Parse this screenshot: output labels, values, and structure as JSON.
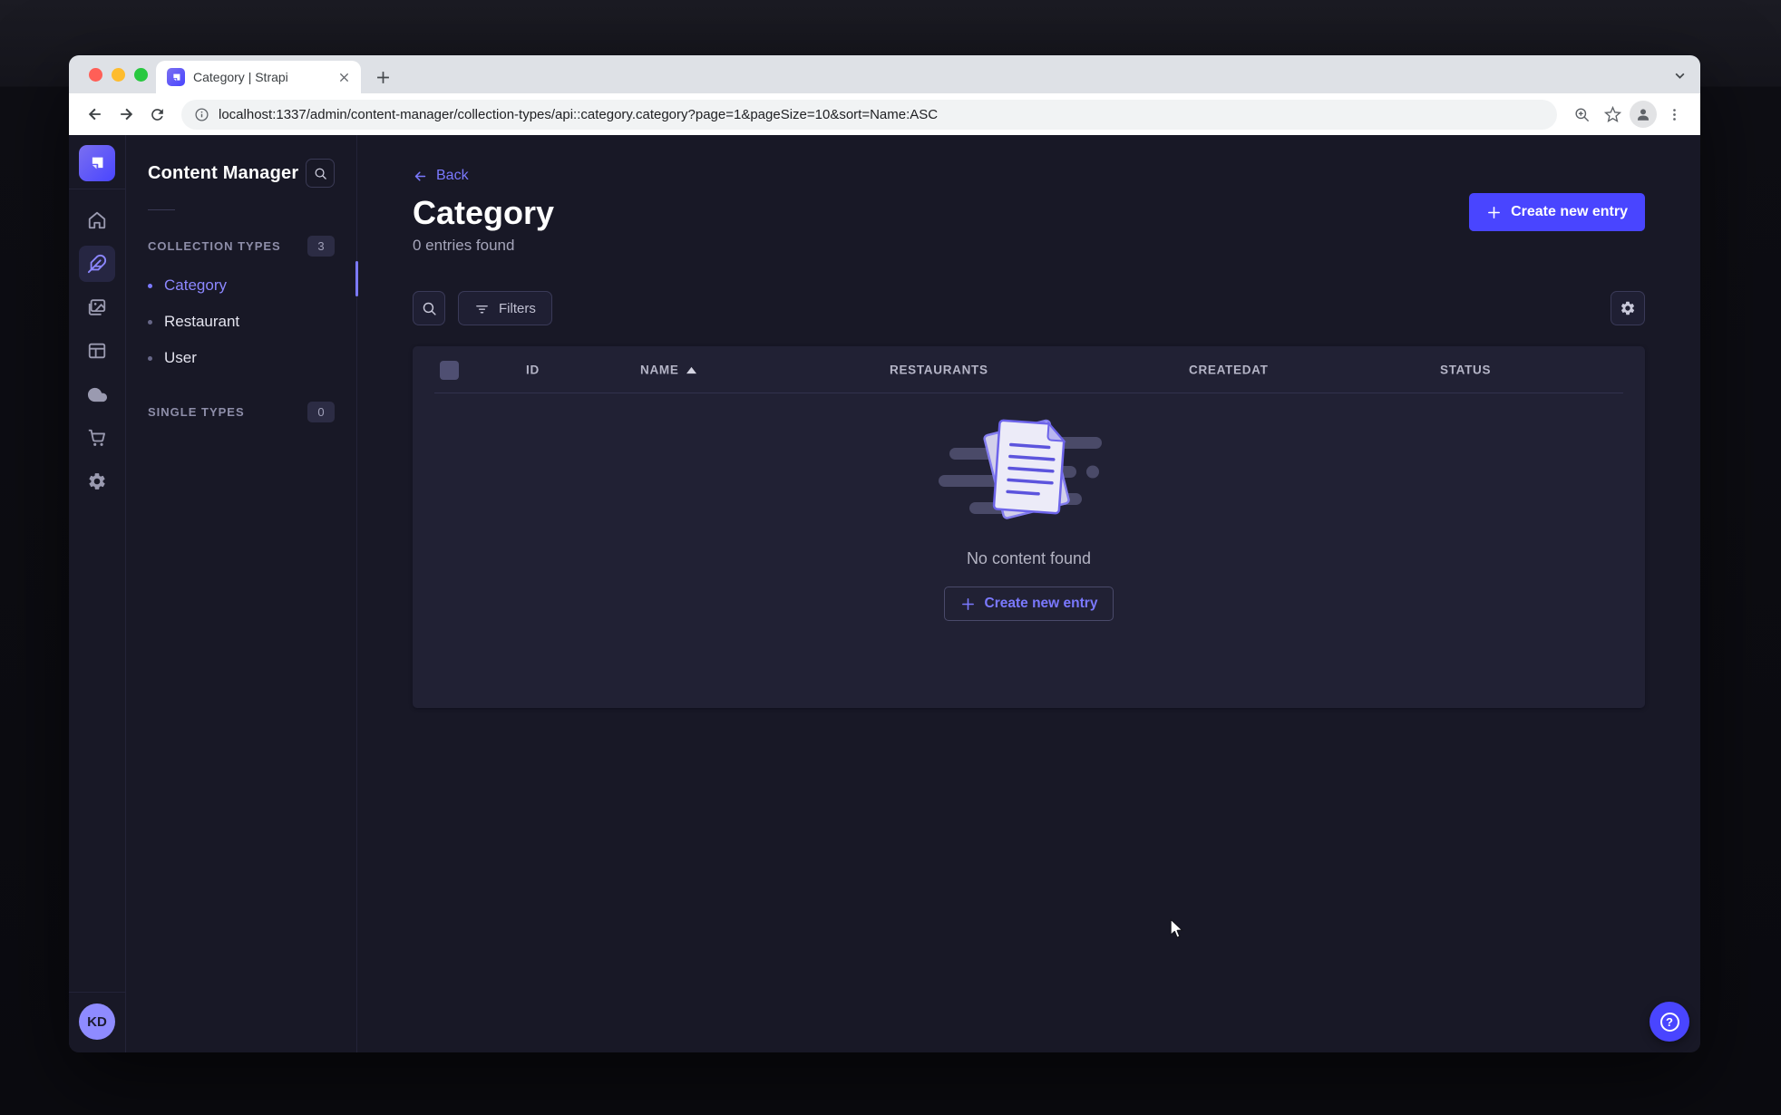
{
  "browser": {
    "tab_title": "Category | Strapi",
    "url": "localhost:1337/admin/content-manager/collection-types/api::category.category?page=1&pageSize=10&sort=Name:ASC"
  },
  "rail": {
    "icons": [
      "strapi-logo",
      "home",
      "content-manager",
      "media-library",
      "content-type-builder",
      "deployments",
      "marketplace",
      "settings"
    ],
    "active_icon": "content-manager",
    "user_initials": "KD"
  },
  "subsidebar": {
    "title": "Content Manager",
    "sections": [
      {
        "label": "COLLECTION TYPES",
        "badge": "3"
      },
      {
        "label": "SINGLE TYPES",
        "badge": "0"
      }
    ],
    "collection_items": [
      {
        "label": "Category",
        "active": true
      },
      {
        "label": "Restaurant",
        "active": false
      },
      {
        "label": "User",
        "active": false
      }
    ]
  },
  "main": {
    "back_label": "Back",
    "title": "Category",
    "entries_count": "0 entries found",
    "create_button_label": "Create new entry",
    "filters_label": "Filters",
    "table_columns": [
      "ID",
      "NAME",
      "RESTAURANTS",
      "CREATEDAT",
      "STATUS"
    ],
    "sort": {
      "column": "NAME",
      "direction": "ASC"
    },
    "empty_state": {
      "message": "No content found",
      "create_button_label": "Create new entry"
    }
  },
  "colors": {
    "primary": "#4945ff",
    "primary_light": "#7b79ff",
    "app_background": "#181826",
    "surface": "#212134",
    "border": "#32324d"
  }
}
